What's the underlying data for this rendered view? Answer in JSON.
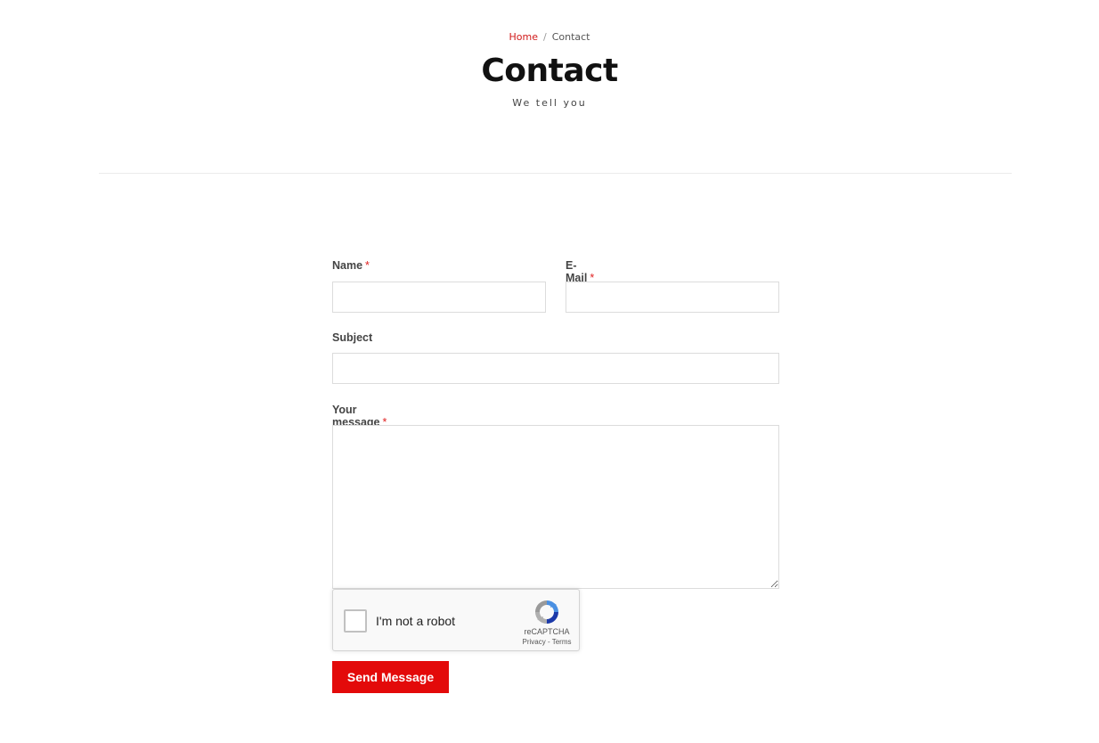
{
  "breadcrumb": {
    "home": "Home",
    "separator": "/",
    "current": "Contact"
  },
  "header": {
    "title": "Contact",
    "subtitle": "We tell you"
  },
  "form": {
    "name_label": "Name",
    "email_label": "E-Mail",
    "subject_label": "Subject",
    "message_label": "Your message",
    "required_marker": "*",
    "name_value": "",
    "email_value": "",
    "subject_value": "",
    "message_value": "",
    "submit_label": "Send Message"
  },
  "recaptcha": {
    "label": "I'm not a robot",
    "brand": "reCAPTCHA",
    "links": "Privacy - Terms",
    "checked": false
  },
  "colors": {
    "accent": "#e30a0a",
    "link": "#d11a1a"
  }
}
